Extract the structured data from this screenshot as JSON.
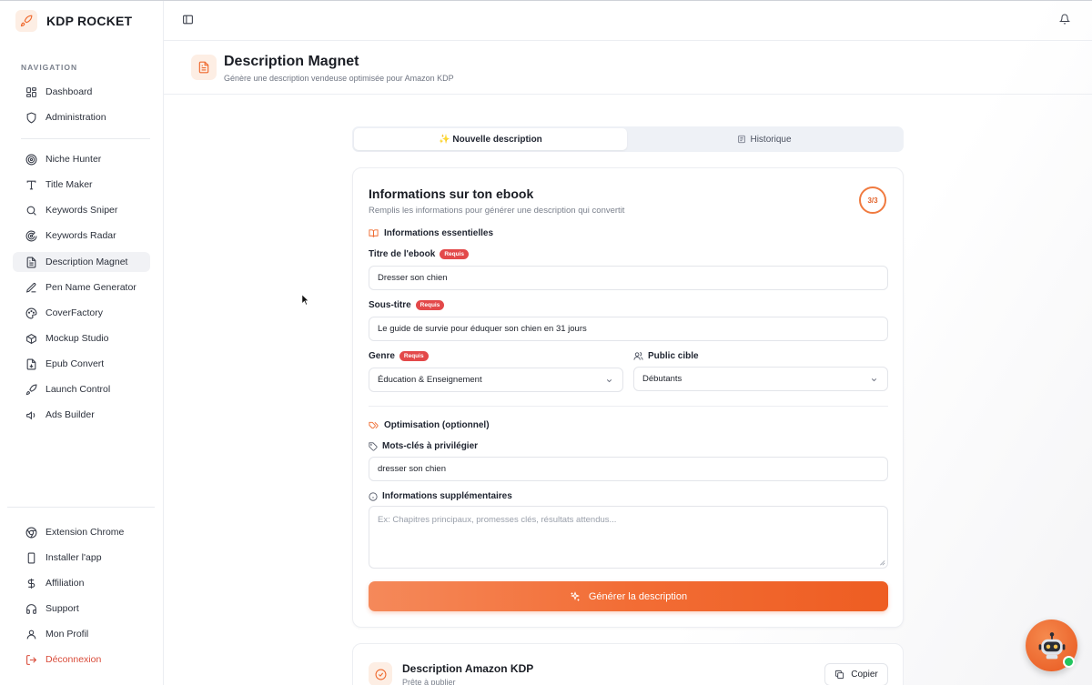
{
  "app": {
    "name": "KDP ROCKET"
  },
  "sidebar": {
    "section_title": "NAVIGATION",
    "group1": [
      {
        "label": "Dashboard",
        "icon": "dashboard-icon"
      },
      {
        "label": "Administration",
        "icon": "shield-icon"
      }
    ],
    "group2": [
      {
        "label": "Niche Hunter",
        "icon": "target-icon"
      },
      {
        "label": "Title Maker",
        "icon": "type-icon"
      },
      {
        "label": "Keywords Sniper",
        "icon": "search-icon"
      },
      {
        "label": "Keywords Radar",
        "icon": "radar-icon"
      },
      {
        "label": "Description Magnet",
        "icon": "document-icon",
        "active": true
      },
      {
        "label": "Pen Name Generator",
        "icon": "pen-icon"
      },
      {
        "label": "CoverFactory",
        "icon": "palette-icon"
      },
      {
        "label": "Mockup Studio",
        "icon": "box-icon"
      },
      {
        "label": "Epub Convert",
        "icon": "file-convert-icon"
      },
      {
        "label": "Launch Control",
        "icon": "rocket-icon"
      },
      {
        "label": "Ads Builder",
        "icon": "megaphone-icon"
      }
    ],
    "bottom": [
      {
        "label": "Extension Chrome",
        "icon": "chrome-icon"
      },
      {
        "label": "Installer l'app",
        "icon": "smartphone-icon"
      },
      {
        "label": "Affiliation",
        "icon": "dollar-icon"
      },
      {
        "label": "Support",
        "icon": "headphones-icon"
      },
      {
        "label": "Mon Profil",
        "icon": "user-icon"
      },
      {
        "label": "Déconnexion",
        "icon": "logout-icon",
        "danger": true
      }
    ]
  },
  "page": {
    "title": "Description Magnet",
    "subtitle": "Génère une description vendeuse optimisée pour Amazon KDP"
  },
  "tabs": {
    "new": "✨ Nouvelle description",
    "history": "Historique"
  },
  "form": {
    "title": "Informations sur ton ebook",
    "subtitle": "Remplis les informations pour générer une description qui convertit",
    "step": "3/3",
    "section_essentials": "Informations essentielles",
    "required_badge": "Requis",
    "title_label": "Titre de l'ebook",
    "title_value": "Dresser son chien",
    "subtitle_label": "Sous-titre",
    "subtitle_value": "Le guide de survie pour éduquer son chien en 31 jours",
    "genre_label": "Genre",
    "genre_value": "Éducation & Enseignement",
    "audience_label": "Public cible",
    "audience_value": "Débutants",
    "section_optimisation": "Optimisation (optionnel)",
    "keywords_label": "Mots-clés à privilégier",
    "keywords_value": "dresser son chien",
    "extra_label": "Informations supplémentaires",
    "extra_placeholder": "Ex: Chapitres principaux, promesses clés, résultats attendus...",
    "generate_button": "Générer la description"
  },
  "result": {
    "title": "Description Amazon KDP",
    "subtitle": "Prête à publier",
    "copy_button": "Copier"
  },
  "colors": {
    "accent": "#f26d35",
    "danger": "#d94a38",
    "badge": "#e3494a",
    "online": "#22c55e"
  }
}
